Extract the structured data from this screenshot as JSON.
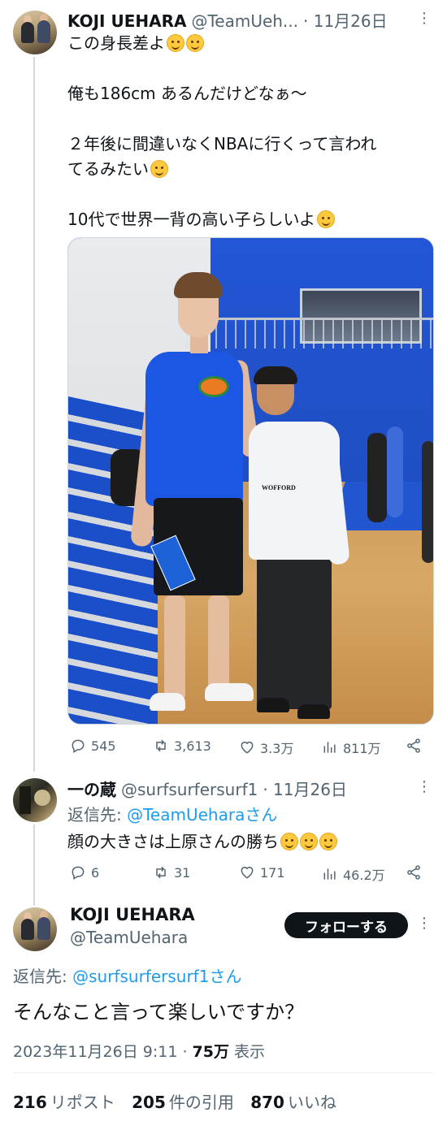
{
  "tweet1": {
    "name": "KOJI UEHARA",
    "handle": "@TeamUeh...",
    "date": "· 11月26日",
    "lines": [
      "この身長差よ",
      "",
      "俺も186cm あるんだけどなぁ〜",
      "",
      "２年後に間違いなくNBAに行くって言われ",
      "てるみたい",
      "",
      "10代で世界一背の高い子らしいよ"
    ],
    "photo_shirt_text": "WOFFORD",
    "actions": {
      "reply": "545",
      "retweet": "3,613",
      "like": "3.3万",
      "views": "811万"
    }
  },
  "tweet2": {
    "name": "一の蔵",
    "handle": "@surfsurfersurf1",
    "date": "· 11月26日",
    "reply_prefix": "返信先: ",
    "reply_to": "@TeamUeharaさん",
    "text": "顔の大きさは上原さんの勝ち",
    "actions": {
      "reply": "6",
      "retweet": "31",
      "like": "171",
      "views": "46.2万"
    }
  },
  "tweet3": {
    "name": "KOJI  UEHARA",
    "handle": "@TeamUehara",
    "follow_label": "フォローする",
    "reply_prefix": "返信先: ",
    "reply_to": "@surfsurfersurf1さん",
    "text": "そんなこと言って楽しいですか？",
    "timestamp": "2023年11月26日 9:11 · ",
    "views_count": "75万",
    "views_label": " 表示",
    "stats": {
      "reposts": "216",
      "reposts_label": "リポスト",
      "quotes": "205",
      "quotes_label": "件の引用",
      "likes": "870",
      "likes_label": "いいね"
    }
  },
  "icons": [
    "reply-icon",
    "retweet-icon",
    "like-icon",
    "views-icon",
    "share-icon",
    "more-icon"
  ],
  "colors": {
    "link": "#1d9bf0",
    "secondary_text": "#536471",
    "follow_button": "#0f1419"
  }
}
